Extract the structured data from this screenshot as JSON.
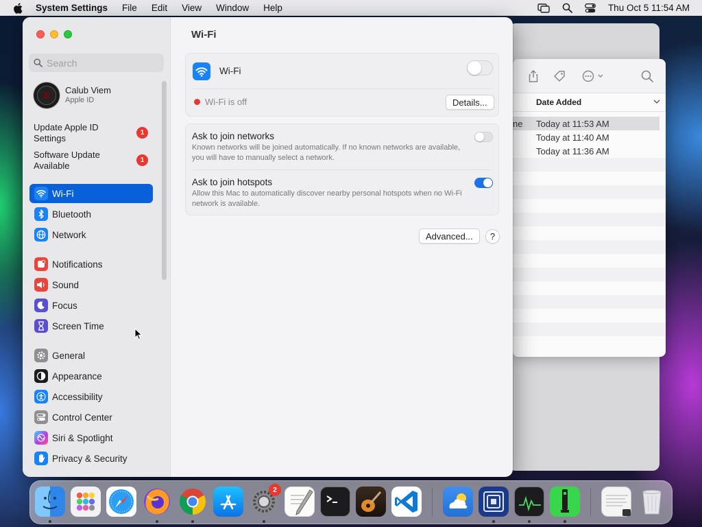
{
  "menubar": {
    "app_name": "System Settings",
    "items": [
      "File",
      "Edit",
      "View",
      "Window",
      "Help"
    ],
    "clock": "Thu Oct 5  11:54 AM"
  },
  "finder": {
    "column_header": "Date Added",
    "rows": [
      {
        "name_fragment": "ne",
        "date": "Today at 11:53 AM"
      },
      {
        "name_fragment": "",
        "date": "Today at 11:40 AM"
      },
      {
        "name_fragment": "",
        "date": "Today at 11:36 AM"
      }
    ]
  },
  "sidebar": {
    "search_placeholder": "Search",
    "profile": {
      "name": "Calub Viem",
      "subtitle": "Apple ID"
    },
    "notices": [
      {
        "label": "Update Apple ID Settings",
        "badge": "1"
      },
      {
        "label": "Software Update Available",
        "badge": "1"
      }
    ],
    "items": [
      {
        "label": "Wi-Fi",
        "icon": "wifi-icon",
        "color": "#1a82f7"
      },
      {
        "label": "Bluetooth",
        "icon": "bluetooth-icon",
        "color": "#1a82f7"
      },
      {
        "label": "Network",
        "icon": "globe-icon",
        "color": "#1a82f7"
      },
      {
        "label": "Notifications",
        "icon": "bell-icon",
        "color": "#e8453c"
      },
      {
        "label": "Sound",
        "icon": "speaker-icon",
        "color": "#e8453c"
      },
      {
        "label": "Focus",
        "icon": "moon-icon",
        "color": "#5a4fcf"
      },
      {
        "label": "Screen Time",
        "icon": "hourglass-icon",
        "color": "#5a4fcf"
      },
      {
        "label": "General",
        "icon": "gear-icon",
        "color": "#8e8e93"
      },
      {
        "label": "Appearance",
        "icon": "appearance-icon",
        "color": "#1c1c1e"
      },
      {
        "label": "Accessibility",
        "icon": "accessibility-icon",
        "color": "#1a82f7"
      },
      {
        "label": "Control Center",
        "icon": "control-center-icon",
        "color": "#8e8e93"
      },
      {
        "label": "Siri & Spotlight",
        "icon": "siri-icon",
        "color": "#b23fe0"
      },
      {
        "label": "Privacy & Security",
        "icon": "hand-icon",
        "color": "#1a82f7"
      }
    ]
  },
  "main": {
    "title": "Wi-Fi",
    "wifi_label": "Wi-Fi",
    "wifi_status": "Wi-Fi is off",
    "details_button": "Details...",
    "ask_networks_title": "Ask to join networks",
    "ask_networks_desc": "Known networks will be joined automatically. If no known networks are available, you will have to manually select a network.",
    "ask_hotspots_title": "Ask to join hotspots",
    "ask_hotspots_desc": "Allow this Mac to automatically discover nearby personal hotspots when no Wi-Fi network is available.",
    "advanced_button": "Advanced...",
    "help_button": "?"
  },
  "dock": {
    "settings_badge": "2"
  }
}
